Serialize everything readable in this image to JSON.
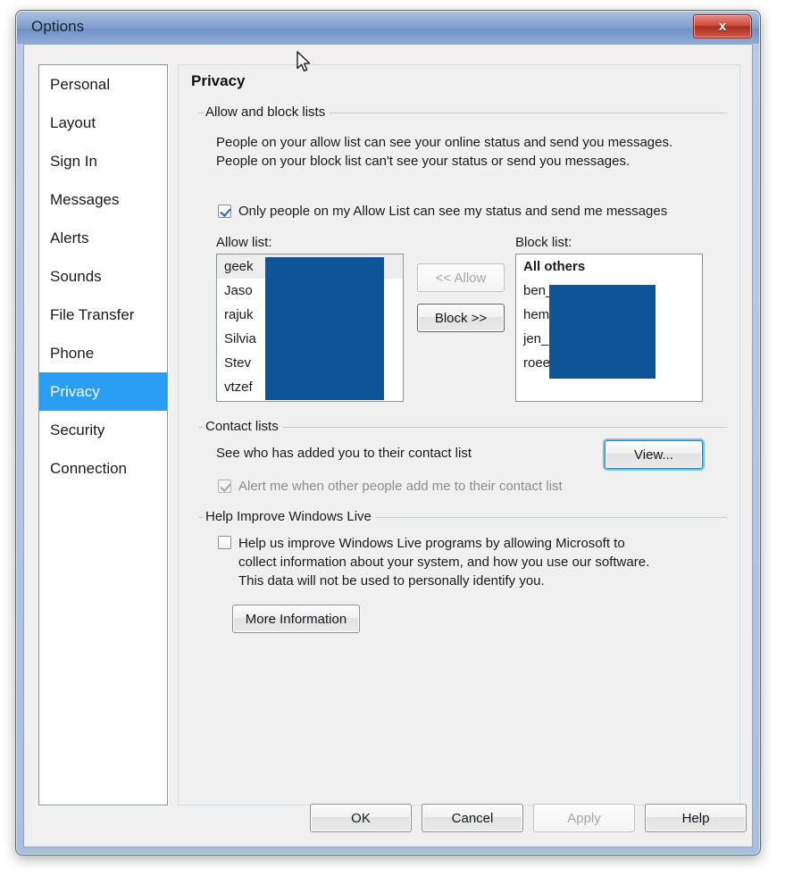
{
  "window": {
    "title": "Options",
    "close_label": "x",
    "close_icon": "close-icon"
  },
  "sidebar": {
    "items": [
      {
        "label": "Personal",
        "selected": false
      },
      {
        "label": "Layout",
        "selected": false
      },
      {
        "label": "Sign In",
        "selected": false
      },
      {
        "label": "Messages",
        "selected": false
      },
      {
        "label": "Alerts",
        "selected": false
      },
      {
        "label": "Sounds",
        "selected": false
      },
      {
        "label": "File Transfer",
        "selected": false
      },
      {
        "label": "Phone",
        "selected": false
      },
      {
        "label": "Privacy",
        "selected": true
      },
      {
        "label": "Security",
        "selected": false
      },
      {
        "label": "Connection",
        "selected": false
      }
    ]
  },
  "pane": {
    "title": "Privacy",
    "groups": {
      "allow_block": {
        "label": "Allow and block lists",
        "description": "People on your allow list can see your online status and send you messages.  People on your block list can't see your status or send you messages.",
        "only_allow_checkbox": {
          "label": "Only people on my Allow List can see my status and send me messages",
          "checked": true,
          "enabled": true
        },
        "allow_list": {
          "label": "Allow list:",
          "items": [
            "geek",
            "Jaso",
            "rajuk",
            "Silvia",
            "Stev",
            "vtzef"
          ]
        },
        "block_list": {
          "label": "Block list:",
          "items": [
            "All others",
            "ben_",
            "hem",
            "jen_",
            "roee"
          ]
        },
        "allow_button": {
          "label": "<< Allow",
          "enabled": false
        },
        "block_button": {
          "label": "Block >>",
          "enabled": true
        }
      },
      "contact_lists": {
        "label": "Contact lists",
        "description": "See who has added you to their contact list",
        "view_button": {
          "label": "View...",
          "focused": true
        },
        "alert_checkbox": {
          "label": "Alert me when other people add me to their contact list",
          "checked": true,
          "enabled": false
        }
      },
      "help_improve": {
        "label": "Help Improve Windows Live",
        "checkbox": {
          "label": "Help us improve Windows Live programs by allowing Microsoft to collect information about your system, and how you use our software. This data will not be used to personally identify you.",
          "checked": false,
          "enabled": true
        },
        "more_info_button": {
          "label": "More Information"
        }
      }
    }
  },
  "footer": {
    "ok": {
      "label": "OK",
      "enabled": true
    },
    "cancel": {
      "label": "Cancel",
      "enabled": true
    },
    "apply": {
      "label": "Apply",
      "enabled": false
    },
    "help": {
      "label": "Help",
      "enabled": true
    }
  },
  "colors": {
    "selection_blue": "#2a9df4",
    "redaction_blue": "#0d5596",
    "titlebar_blue": "#6f8fc7",
    "close_red": "#cf4a3d",
    "focus_glow": "#66c5f2"
  }
}
